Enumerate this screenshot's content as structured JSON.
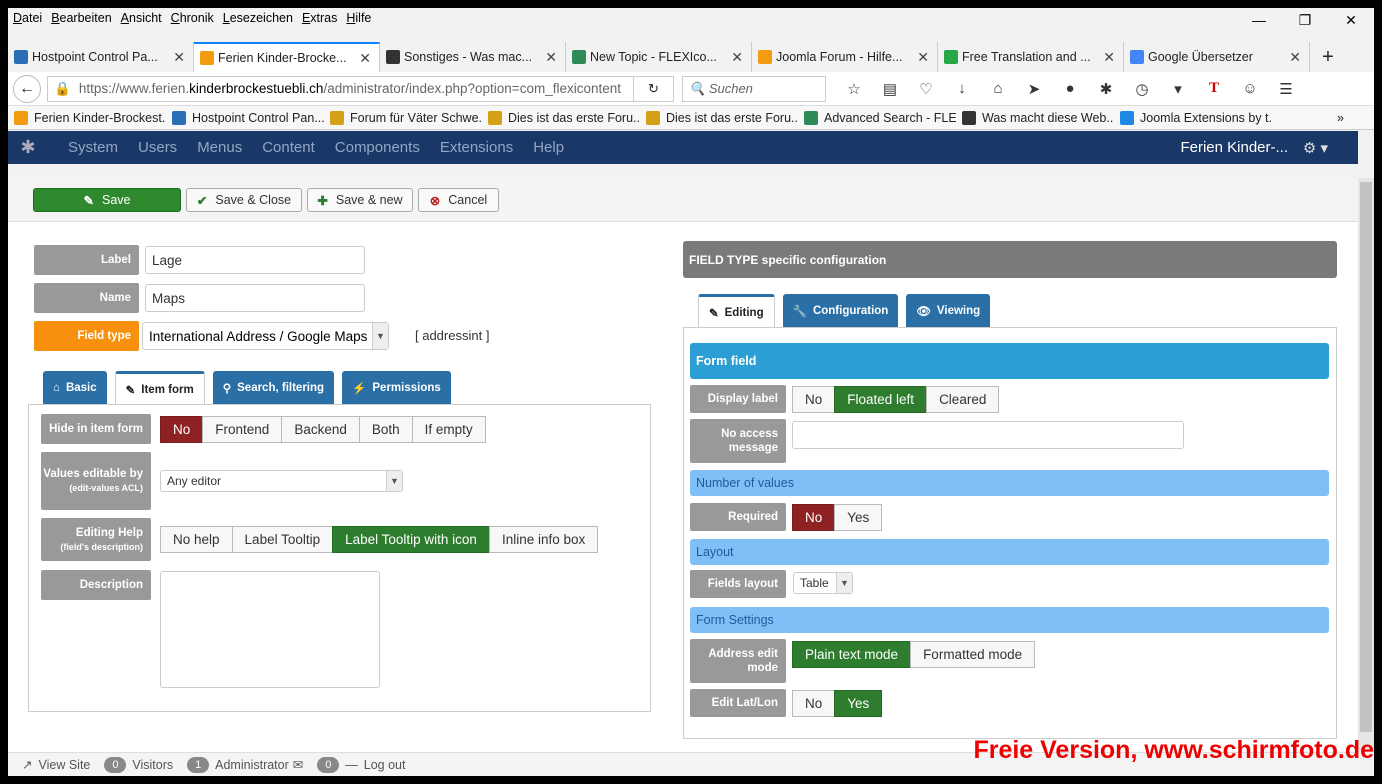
{
  "menubar": [
    "Datei",
    "Bearbeiten",
    "Ansicht",
    "Chronik",
    "Lesezeichen",
    "Extras",
    "Hilfe"
  ],
  "window_controls": [
    "—",
    "❐",
    "✕"
  ],
  "tabs": [
    {
      "title": "Hostpoint Control Pa...",
      "color": "#2a6fb5"
    },
    {
      "title": "Ferien Kinder-Brocke...",
      "color": "#f39c12"
    },
    {
      "title": "Sonstiges - Was mac...",
      "color": "#333"
    },
    {
      "title": "New Topic - FLEXIco...",
      "color": "#2e8b57"
    },
    {
      "title": "Joomla Forum - Hilfe...",
      "color": "#f39c12"
    },
    {
      "title": "Free Translation and ...",
      "color": "#27a844"
    },
    {
      "title": "Google Übersetzer",
      "color": "#4285f4"
    }
  ],
  "tab_close": "✕",
  "new_tab": "+",
  "nav": {
    "url_prefix": "https://www.ferien.",
    "url_domain": "kinderbrockestuebli.ch",
    "url_rest": "/administrator/index.php?option=com_flexicontent",
    "search_placeholder": "Suchen"
  },
  "bookmarks": [
    "Ferien Kinder-Brockest...",
    "Hostpoint Control Pan...",
    "Forum für Väter Schwe...",
    "Dies ist das erste Foru...",
    "Dies ist das erste Foru...",
    "Advanced Search - FLE...",
    "Was macht diese Web...",
    "Joomla Extensions by t..."
  ],
  "joomla_nav": {
    "items": [
      "System",
      "Users",
      "Menus",
      "Content",
      "Components",
      "Extensions",
      "Help"
    ],
    "site": "Ferien Kinder-..."
  },
  "toolbar": {
    "save": "Save",
    "save_close": "Save & Close",
    "save_new": "Save & new",
    "cancel": "Cancel"
  },
  "left": {
    "label_label": "Label",
    "label_value": "Lage",
    "name_label": "Name",
    "name_value": "Maps",
    "fieldtype_label": "Field type",
    "fieldtype_value": "International Address / Google Maps",
    "fieldtype_code": "[ addressint ]",
    "tabs": [
      "Basic",
      "Item form",
      "Search, filtering",
      "Permissions"
    ],
    "hide_label": "Hide in item form",
    "hide_options": [
      "No",
      "Frontend",
      "Backend",
      "Both",
      "If empty"
    ],
    "values_label": "Values editable by",
    "values_sub": "(edit-values ACL)",
    "values_value": "Any editor",
    "help_label": "Editing Help",
    "help_sub": "(field's description)",
    "help_options": [
      "No help",
      "Label Tooltip",
      "Label Tooltip with icon",
      "Inline info box"
    ],
    "desc_label": "Description"
  },
  "right": {
    "header": "FIELD TYPE specific configuration",
    "tabs": [
      "Editing",
      "Configuration",
      "Viewing"
    ],
    "form_field": "Form field",
    "display_label": "Display label",
    "display_options": [
      "No",
      "Floated left",
      "Cleared"
    ],
    "noaccess_label": "No access message",
    "num_values": "Number of values",
    "required_label": "Required",
    "required_options": [
      "No",
      "Yes"
    ],
    "layout": "Layout",
    "fields_layout_label": "Fields layout",
    "fields_layout_value": "Table",
    "form_settings": "Form Settings",
    "address_label": "Address edit mode",
    "address_options": [
      "Plain text mode",
      "Formatted mode"
    ],
    "latlon_label": "Edit Lat/Lon",
    "latlon_options": [
      "No",
      "Yes"
    ]
  },
  "status": {
    "view_site": "View Site",
    "visitors_count": "0",
    "visitors": "Visitors",
    "admin_count": "1",
    "admin": "Administrator",
    "msg_count": "0",
    "logout": "Log out"
  },
  "watermark": "Freie Version, www.schirmfoto.de"
}
